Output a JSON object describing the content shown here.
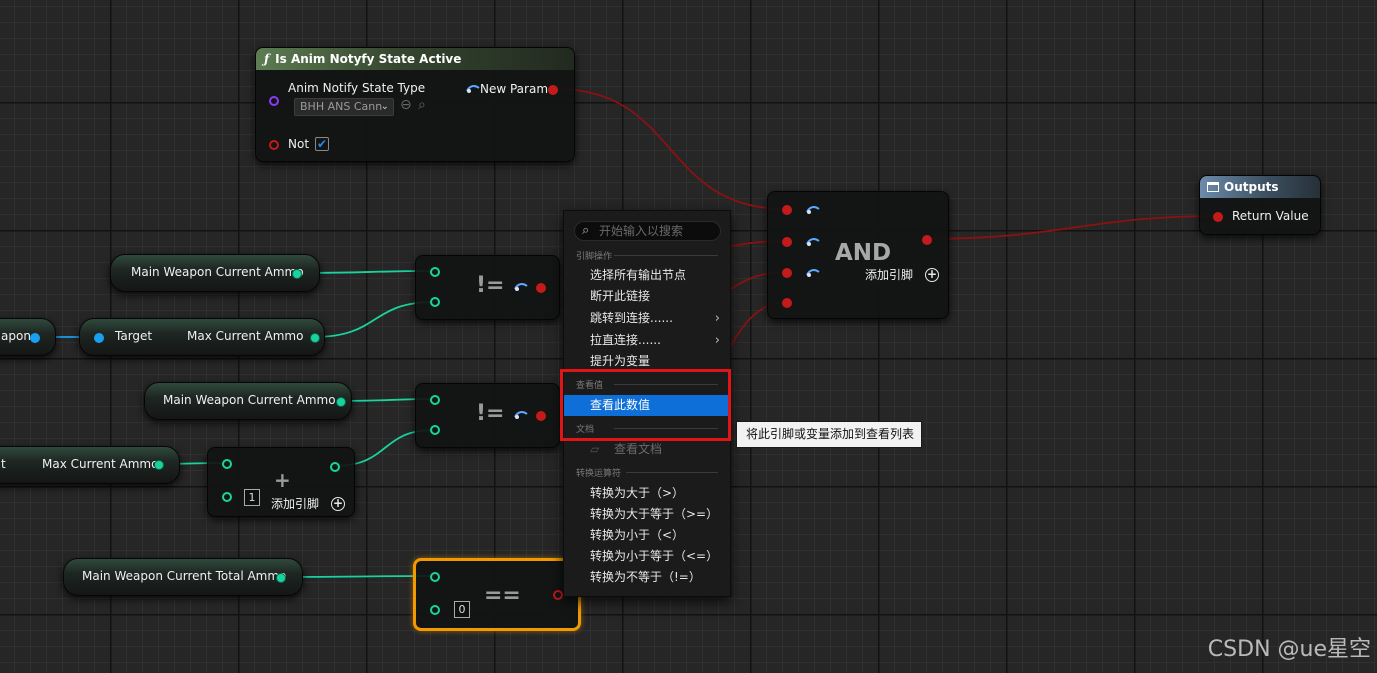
{
  "is_anim_node": {
    "title": "Is Anim Notyfy State Active",
    "icon": "ƒ",
    "pin_type_label": "Anim Notify State Type",
    "dropdown_value": "BHH ANS Cann",
    "not_label": "Not",
    "not_checked": true,
    "output_label": "New Param"
  },
  "variable_nodes": [
    {
      "label": "Main Weapon Current Ammo"
    },
    {
      "label": "apon"
    },
    {
      "label": "Target",
      "output": "Max Current Ammo"
    },
    {
      "label": "Main Weapon Current Ammo"
    },
    {
      "label": "t",
      "output": "Max Current Ammo"
    },
    {
      "label": "Main Weapon Current Total Ammo"
    }
  ],
  "operators": {
    "not_equal_1": "!=",
    "not_equal_2": "!=",
    "add": "+",
    "add_pin_label": "添加引脚",
    "add_default": "1",
    "equal": "==",
    "equal_default": "0"
  },
  "and_node": {
    "label": "AND",
    "add_pin_label": "添加引脚"
  },
  "outputs_node": {
    "title": "Outputs",
    "return_label": "Return Value"
  },
  "context_menu": {
    "search_placeholder": "开始输入以搜索",
    "section_pin_actions": "引脚操作",
    "items_pin": [
      {
        "label": "选择所有输出节点",
        "has_submenu": false
      },
      {
        "label": "断开此链接",
        "has_submenu": false
      },
      {
        "label": "跳转到连接......",
        "has_submenu": true
      },
      {
        "label": "拉直连接......",
        "has_submenu": true
      },
      {
        "label": "提升为变量",
        "has_submenu": false
      }
    ],
    "section_watch": "查看值",
    "watch_item": "查看此数值",
    "section_docs": "文档",
    "docs_item": "查看文档",
    "section_convert": "转换运算符",
    "items_convert": [
      "转换为大于（>）",
      "转换为大于等于（>=）",
      "转换为小于（<）",
      "转换为小于等于（<=）",
      "转换为不等于（!=）"
    ]
  },
  "tooltip": "将此引脚或变量添加到查看列表",
  "watermark": "CSDN @ue星空",
  "colors": {
    "float_pin": "#19d39e",
    "object_pin": "#1aa0f0",
    "bool_pin": "#c41a1a",
    "class_pin": "#8a3cf5",
    "menu_highlight": "#0e6fd8",
    "selection_outline": "#f29a00",
    "annotation_box": "#e01515"
  }
}
